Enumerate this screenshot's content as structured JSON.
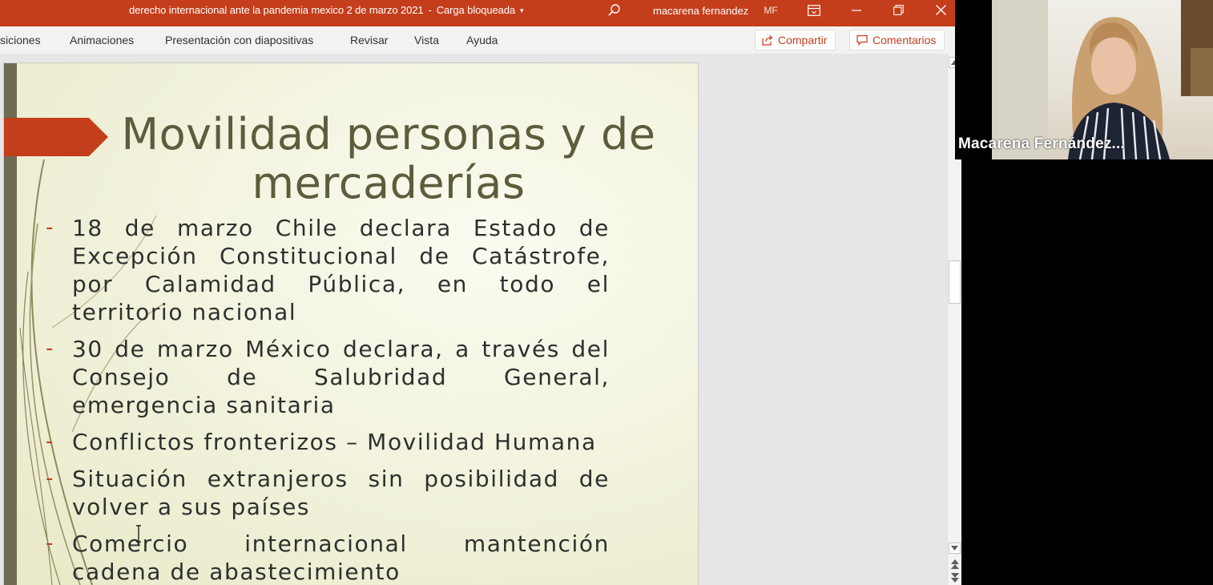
{
  "titlebar": {
    "document_title": "derecho internacional ante la pandemia mexico 2 de marzo 2021",
    "separator": "-",
    "status": "Carga bloqueada",
    "status_caret": "▾",
    "user_name": "macarena fernandez",
    "user_initials": "MF"
  },
  "ribbon": {
    "tabs": [
      {
        "label": "siciones"
      },
      {
        "label": "Animaciones"
      },
      {
        "label": "Presentación con diapositivas"
      },
      {
        "label": "Revisar"
      },
      {
        "label": "Vista"
      },
      {
        "label": "Ayuda"
      }
    ],
    "share_label": "Compartir",
    "comments_label": "Comentarios"
  },
  "slide": {
    "title_line1": "Movilidad personas y de",
    "title_line2": "mercaderías",
    "bullet_marker": "-",
    "bullets": [
      "18 de marzo Chile declara  Estado de Excepción Constitucional de Catástrofe, por Calamidad Pública, en todo el territorio nacional",
      "30 de marzo México declara,  a través del Consejo de Salubridad General,  emergencia sanitaria",
      "Conflictos fronterizos – Movilidad Humana",
      "Situación extranjeros sin posibilidad de volver a sus países",
      "Comercio internacional mantención cadena de abastecimiento"
    ]
  },
  "video": {
    "participant_name": "Macarena Fernández..."
  },
  "colors": {
    "brand": "#c43e1c",
    "slide_title": "#5d5c3c",
    "arrow": "#c43e1c"
  }
}
